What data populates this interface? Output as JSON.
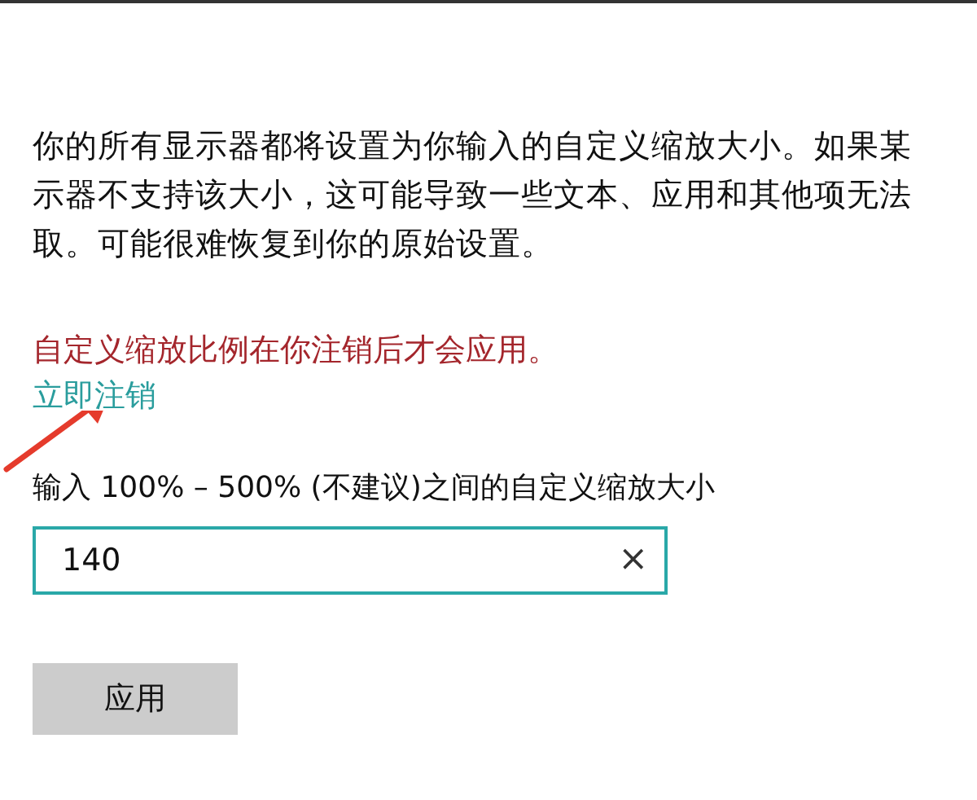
{
  "description_lines": [
    "你的所有显示器都将设置为你输入的自定义缩放大小。如果某",
    "示器不支持该大小，这可能导致一些文本、应用和其他项无法",
    "取。可能很难恢复到你的原始设置。"
  ],
  "warning": "自定义缩放比例在你注销后才会应用。",
  "sign_out_link": "立即注销",
  "scale_field": {
    "label": "输入 100% – 500% (不建议)之间的自定义缩放大小",
    "value": "140",
    "clear": "×"
  },
  "apply_button": "应用"
}
